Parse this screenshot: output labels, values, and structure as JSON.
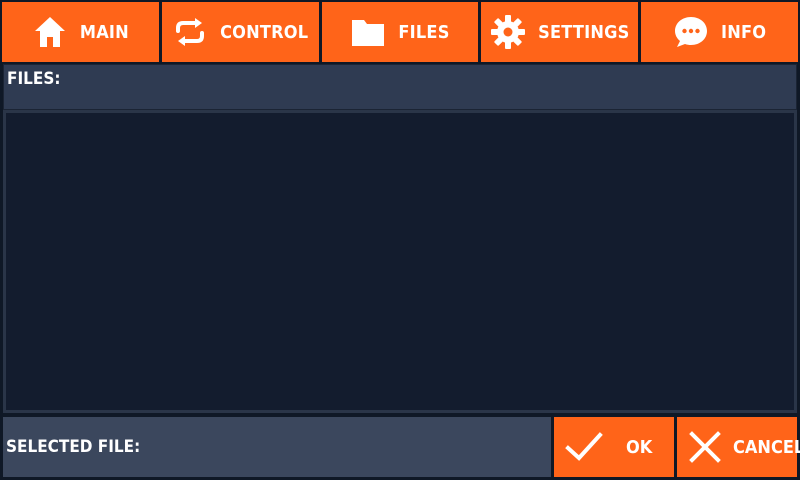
{
  "nav": {
    "tabs": [
      {
        "label": "MAIN",
        "icon": "home-icon"
      },
      {
        "label": "CONTROL",
        "icon": "refresh-icon"
      },
      {
        "label": "FILES",
        "icon": "folder-icon"
      },
      {
        "label": "SETTINGS",
        "icon": "gear-icon"
      },
      {
        "label": "INFO",
        "icon": "chat-bubble-icon"
      }
    ]
  },
  "files_panel": {
    "title": "FILES:",
    "items": []
  },
  "selected_file": {
    "label": "SELECTED FILE:",
    "value": ""
  },
  "actions": {
    "ok_label": "OK",
    "cancel_label": "CANCEL"
  },
  "colors": {
    "accent": "#ff6419",
    "background": "#0f1826",
    "panel_header": "#2f3b52",
    "list_bg": "#131c2e",
    "selected_bar": "#3b475d",
    "text": "#ffffff"
  }
}
